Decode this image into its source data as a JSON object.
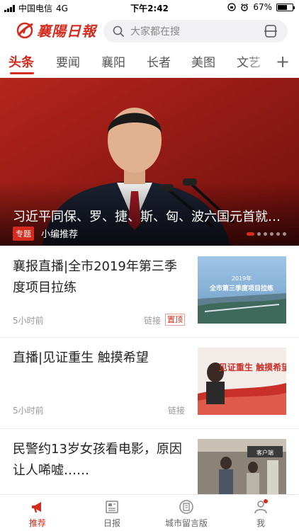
{
  "status_bar": {
    "carrier": "中国电信",
    "network": "4G",
    "time": "下午2:42",
    "battery": "67%",
    "battery_level": 0.67
  },
  "header": {
    "logo_text": "襄陽日報",
    "search_placeholder": "大家都在搜"
  },
  "tabs": [
    {
      "label": "头条",
      "active": true
    },
    {
      "label": "要闻"
    },
    {
      "label": "襄阳"
    },
    {
      "label": "长者"
    },
    {
      "label": "美图"
    },
    {
      "label": "文艺"
    }
  ],
  "tab_more_label": "+",
  "hero": {
    "title": "习近平同保、罗、捷、斯、匈、波六国元首就…",
    "tag": "专题",
    "label": "小编推荐",
    "slides": 6,
    "active_slide": 1
  },
  "news": [
    {
      "title": "襄报直播|全市2019年第三季度项目拉练",
      "time": "5小时前",
      "type": "链接",
      "badge": "置顶",
      "thumb_top": "2019年",
      "thumb_caption": "全市第三季度项目拉练"
    },
    {
      "title": "直播|见证重生 触摸希望",
      "time": "5小时前",
      "type": "链接",
      "thumb_caption": "见证重生 触摸希望"
    },
    {
      "title": "民警约13岁女孩看电影，原因让人唏嘘……",
      "thumb_caption": "客户端"
    }
  ],
  "bottom_nav": [
    {
      "label": "推荐",
      "icon": "megaphone-icon",
      "active": true
    },
    {
      "label": "日报",
      "icon": "newspaper-icon"
    },
    {
      "label": "城市留言版",
      "icon": "message-board-icon"
    },
    {
      "label": "我",
      "icon": "user-icon"
    }
  ],
  "colors": {
    "accent": "#d52b1e",
    "text": "#222222",
    "muted": "#999999"
  }
}
